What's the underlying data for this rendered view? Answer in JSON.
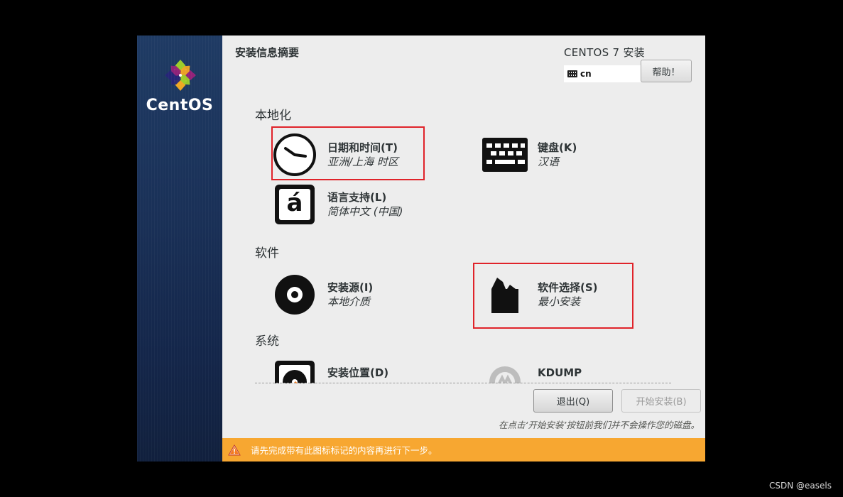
{
  "sidebar": {
    "logo_text": "CentOS"
  },
  "header": {
    "title": "安装信息摘要",
    "product": "CENTOS 7 安装",
    "keyboard_layout": "cn",
    "help_label": "帮助！"
  },
  "sections": {
    "localization": "本地化",
    "software": "软件",
    "system": "系统"
  },
  "spokes": {
    "datetime": {
      "title": "日期和时间(T)",
      "status": "亚洲/上海 时区",
      "icon": "clock-icon"
    },
    "keyboard": {
      "title": "键盘(K)",
      "status": "汉语",
      "icon": "keyboard-icon"
    },
    "language": {
      "title": "语言支持(L)",
      "status": "简体中文 (中国)",
      "icon": "language-icon",
      "icon_glyph": "á"
    },
    "source": {
      "title": "安装源(I)",
      "status": "本地介质",
      "icon": "disc-icon"
    },
    "software_selection": {
      "title": "软件选择(S)",
      "status": "最小安装",
      "icon": "package-icon"
    },
    "destination": {
      "title": "安装位置(D)",
      "icon": "harddisk-icon"
    },
    "kdump": {
      "title": "KDUMP",
      "icon": "kdump-icon"
    }
  },
  "footer": {
    "quit_label": "退出(Q)",
    "begin_label": "开始安装(B)",
    "hint": "在点击‘开始安装’按钮前我们并不会操作您的磁盘。"
  },
  "warning": {
    "text": "请先完成带有此图标标记的内容再进行下一步。",
    "color": "#f7a731",
    "icon": "warning-icon"
  },
  "watermark": "CSDN @easels",
  "colors": {
    "highlight_box": "#e0232a",
    "sidebar": "#1a3158"
  }
}
